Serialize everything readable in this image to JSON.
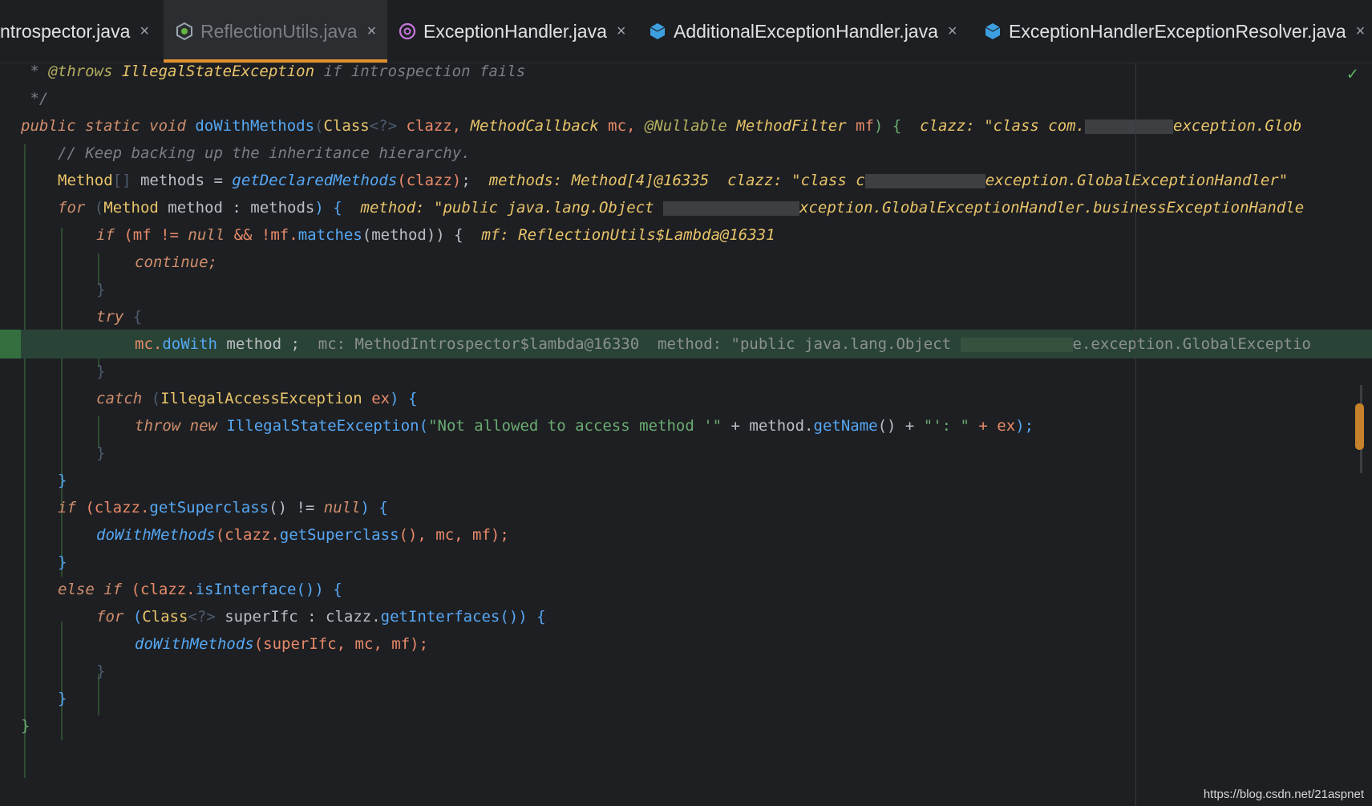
{
  "tabs": [
    {
      "label": "ntrospector.java",
      "icon": "java-class-icon",
      "active": false
    },
    {
      "label": "ReflectionUtils.java",
      "icon": "java-abstract-class-icon",
      "active": true
    },
    {
      "label": "ExceptionHandler.java",
      "icon": "annotation-icon",
      "active": false
    },
    {
      "label": "AdditionalExceptionHandler.java",
      "icon": "java-class-icon",
      "active": false
    },
    {
      "label": "ExceptionHandlerExceptionResolver.java",
      "icon": "java-class-icon",
      "active": false
    }
  ],
  "close_glyph": "×",
  "status_check": "✓",
  "code": {
    "l1": {
      "star": " * ",
      "tag": "@throws",
      "exc": " IllegalStateException",
      "rest": " if introspection fails"
    },
    "l2": {
      "text": " */"
    },
    "l3": {
      "pub": "public static void ",
      "name": "doWithMethods",
      "p1": "(",
      "cls": "Class",
      "gen": "<?>",
      "clazz": " clazz, ",
      "mctype": "MethodCallback",
      "mc": " mc, ",
      "ann": "@Nullable",
      "mftype": " MethodFilter",
      "mf": " mf",
      "end": ") {",
      "hint": "  clazz: \"class com.",
      "hint2": "exception.Glob"
    },
    "l4": {
      "text": "// Keep backing up the inheritance hierarchy."
    },
    "l5": {
      "type": "Method",
      "arr": "[]",
      "methods": " methods = ",
      "call": "getDeclaredMethods",
      "args": "(clazz)",
      "semi": ";",
      "hint": "  methods: Method[4]@16335  clazz: \"class c",
      "hint2": "exception.GlobalExceptionHandler\""
    },
    "l6": {
      "for": "for ",
      "p": "(",
      "type": "Method",
      "var": " method : methods",
      "end": ") {",
      "hint": "  method: \"public java.lang.Object ",
      "hint2": "xception.GlobalExceptionHandler.businessExceptionHandle"
    },
    "l7": {
      "if": "if ",
      "cond1": "(mf != ",
      "null": "null",
      "cond2": " && !mf.",
      "matches": "matches",
      "cond3": "(method)) {",
      "hint": "  mf: ReflectionUtils$Lambda@16331"
    },
    "l8": {
      "text": "continue;"
    },
    "l9": {
      "text": "}"
    },
    "l10": {
      "try": "try ",
      "brace": "{"
    },
    "l11": {
      "mc": "mc.",
      "call": "doWith",
      "rest": " method ;",
      "hint": "  mc: MethodIntrospector$lambda@16330  method: \"public java.lang.Object ",
      "hint2": "e.exception.GlobalExceptio"
    },
    "l12": {
      "text": "}"
    },
    "l13": {
      "catch": "catch ",
      "p": "(",
      "type": "IllegalAccessException",
      "ex": " ex",
      "end": ") {"
    },
    "l14": {
      "throw": "throw new ",
      "type": "IllegalStateException",
      "p": "(",
      "s1": "\"Not allowed to access method '\"",
      "plus": " + method.",
      "getname": "getName",
      "rest": "() + ",
      "s2": "\"': \"",
      "plus2": " + ex",
      "end": ");"
    },
    "l15": {
      "text": "}"
    },
    "l16": {
      "text": "}"
    },
    "l17": {
      "if": "if ",
      "p": "(clazz.",
      "call": "getSuperclass",
      "rest": "() != ",
      "null": "null",
      "end": ") {"
    },
    "l18": {
      "call": "doWithMethods",
      "args": "(clazz.",
      "call2": "getSuperclass",
      "rest": "(), mc, mf);"
    },
    "l19": {
      "text": "}"
    },
    "l20": {
      "else": "else if ",
      "p": "(clazz.",
      "call": "isInterface",
      "end": "()) {"
    },
    "l21": {
      "for": "for ",
      "p": "(",
      "type": "Class",
      "gen": "<?>",
      "var": " superIfc : clazz.",
      "call": "getInterfaces",
      "end": "()) {"
    },
    "l22": {
      "call": "doWithMethods",
      "args": "(superIfc, mc, mf);"
    },
    "l23": {
      "text": "}"
    },
    "l24": {
      "text": "}"
    },
    "l25": {
      "text": "}"
    }
  },
  "watermark": "https://blog.csdn.net/21aspnet"
}
